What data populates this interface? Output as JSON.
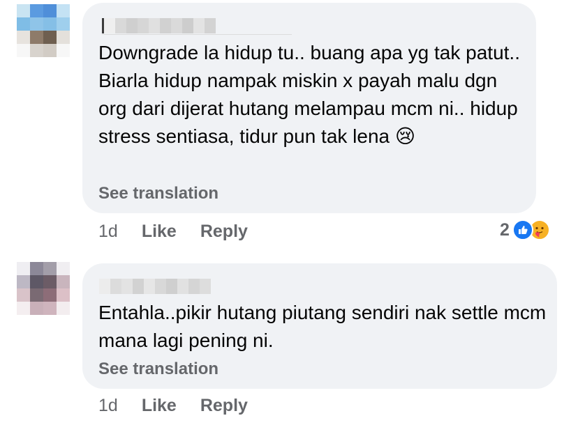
{
  "comments": [
    {
      "text": "Downgrade la hidup tu.. buang apa yg tak patut.. Biarla hidup nampak miskin x payah malu dgn org dari dijerat hutang melampau mcm ni.. hidup stress sentiasa, tidur pun tak lena 😢",
      "see_translation": "See translation",
      "time": "1d",
      "like_label": "Like",
      "reply_label": "Reply",
      "reaction_count": "2",
      "reactions": [
        "like-icon",
        "care-icon"
      ]
    },
    {
      "text": "Entahla..pikir hutang piutang sendiri nak settle mcm mana lagi pening ni.",
      "see_translation": "See translation",
      "time": "1d",
      "like_label": "Like",
      "reply_label": "Reply"
    }
  ],
  "colors": {
    "bubble_bg": "#f0f2f5",
    "secondary_text": "#65676b",
    "like_blue": "#1877f2",
    "care_yellow": "#f7b125"
  }
}
